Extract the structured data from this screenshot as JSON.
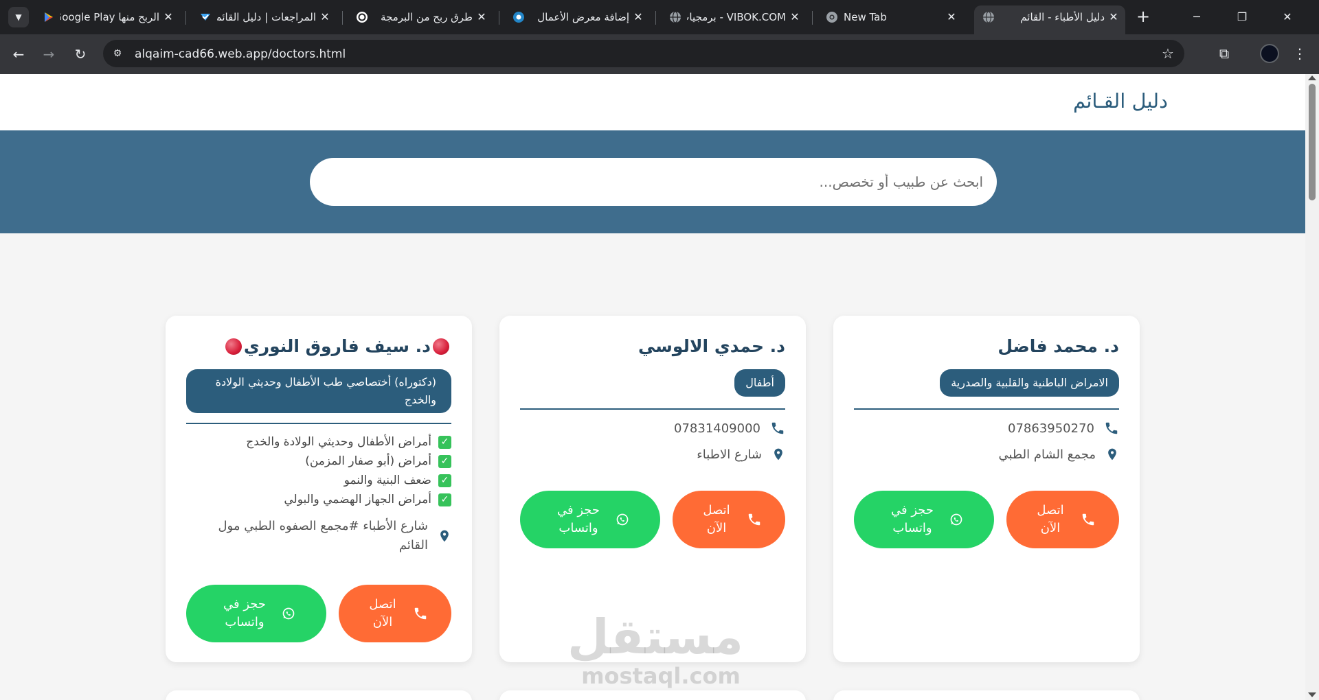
{
  "browser": {
    "tabs": [
      {
        "title": "الربح منها Google Play",
        "favicon": "google-play-icon"
      },
      {
        "title": "المراجعات | دليل القائم",
        "favicon": "app-icon"
      },
      {
        "title": "طرق ربح من البرمجة",
        "favicon": "openai-icon"
      },
      {
        "title": "إضافة معرض الأعمال",
        "favicon": "mostaql-icon"
      },
      {
        "title": "VIBOK.COM - برمجيات",
        "favicon": "globe-icon"
      },
      {
        "title": "New Tab",
        "favicon": "chrome-icon"
      },
      {
        "title": "دليل الأطباء - القائم",
        "favicon": "globe-icon",
        "active": true
      }
    ],
    "url": "alqaim-cad66.web.app/doctors.html"
  },
  "site": {
    "title": "دليل القـائم",
    "search_placeholder": "ابحث عن طبيب أو تخصص..."
  },
  "doctors": [
    {
      "name": "د. محمد فاضل",
      "specialty": "الامراض الباطنية والقلبية والصدرية",
      "phone": "07863950270",
      "address": "مجمع الشام الطبي",
      "call_label": "اتصل الآن",
      "whatsapp_label": "حجز في واتساب"
    },
    {
      "name": "د. حمدي الالوسي",
      "specialty": "أطفال",
      "phone": "07831409000",
      "address": "شارع الاطباء",
      "call_label": "اتصل الآن",
      "whatsapp_label": "حجز في واتساب"
    },
    {
      "name": "د. سيف فاروق النوري",
      "specialty": "(دكتوراه) أختصاصي طب الأطفال وحديثي الولادة والخدج",
      "services": [
        "أمراض الأطفال وحديثي الولادة والخدج",
        "أمراض (أبو صفار المزمن)",
        "ضعف البنية والنمو",
        "أمراض الجهاز الهضمي والبولي"
      ],
      "address": "شارع الأطباء #مجمع الصفوه الطبي مول القائم",
      "call_label": "اتصل الآن",
      "whatsapp_label": "حجز في واتساب"
    }
  ],
  "watermark": {
    "arabic": "مستقل",
    "latin": "mostaql.com"
  },
  "colors": {
    "primary": "#2c5d7c",
    "hero": "#3f6d8d",
    "call": "#ff6b35",
    "whatsapp": "#25d366",
    "check": "#36c25a"
  }
}
